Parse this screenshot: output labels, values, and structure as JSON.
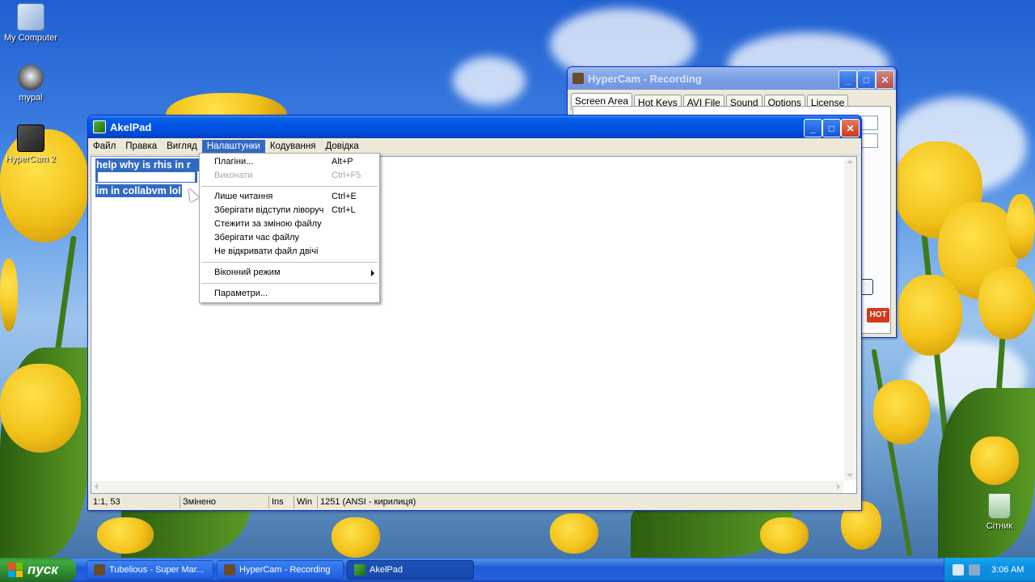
{
  "desktop": {
    "icons": [
      {
        "label": "My Computer"
      },
      {
        "label": "mypal"
      },
      {
        "label": "HyperCam 2"
      },
      {
        "label": "Сітник"
      }
    ]
  },
  "hypercam": {
    "title": "HyperCam - Recording",
    "tabs": [
      "Screen Area",
      "Hot Keys",
      "AVI File",
      "Sound",
      "Options",
      "License"
    ],
    "hot_badge": "HOT"
  },
  "akelpad": {
    "title": "AkelPad",
    "menu": [
      "Файл",
      "Правка",
      "Вигляд",
      "Налаштунки",
      "Кодування",
      "Довідка"
    ],
    "lines": [
      "help why is rhis in r",
      "im in collabvm lol"
    ],
    "status": {
      "position": "1:1, 53",
      "modified": "Змінено",
      "insert": "Ins",
      "newline": "Win",
      "encoding": "1251  (ANSI - кирилиця)"
    }
  },
  "settings_menu": {
    "items": [
      {
        "label": "Плагіни...",
        "shortcut": "Alt+P"
      },
      {
        "label": "Виконати",
        "shortcut": "Ctrl+F5"
      },
      {
        "label": "Лише читання",
        "shortcut": "Ctrl+E"
      },
      {
        "label": "Зберігати відступи ліворуч",
        "shortcut": "Ctrl+L"
      },
      {
        "label": "Стежити за зміною файлу",
        "shortcut": ""
      },
      {
        "label": "Зберігати час файлу",
        "shortcut": ""
      },
      {
        "label": "Не відкривати файл двічі",
        "shortcut": ""
      },
      {
        "label": "Віконний режим",
        "shortcut": ""
      },
      {
        "label": "Параметри...",
        "shortcut": ""
      }
    ]
  },
  "taskbar": {
    "start_label": "пуск",
    "tasks": [
      "Tubelious - Super Mar...",
      "HyperCam - Recording",
      "AkelPad"
    ],
    "clock": "3:06 AM"
  },
  "colors": {
    "selection": "#316ac5",
    "titlebar": "#0054e3",
    "taskbar": "#2157d7",
    "start": "#3fab3f"
  }
}
